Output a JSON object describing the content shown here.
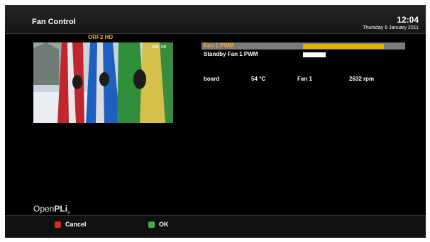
{
  "header": {
    "title": "Fan Control",
    "time": "12:04",
    "date": "Thursday  6 January 2011"
  },
  "preview": {
    "channel": "ORF2 HD",
    "watermark": "ORF HD"
  },
  "settings": [
    {
      "label": "Fan 1 PWM",
      "level": 0.78,
      "selected": true,
      "bar_color": "#e7b000"
    },
    {
      "label": "Standby Fan 1 PWM",
      "level": 0.22,
      "selected": false,
      "bar_color": "#ffffff"
    }
  ],
  "sensors": {
    "name": "board",
    "temp": "54 °C",
    "fan": "Fan 1",
    "rpm": "2632 rpm"
  },
  "brand": {
    "text_thin": "Open",
    "text_bold": "PLi",
    "suffix": "®"
  },
  "footer": {
    "red_label": "Cancel",
    "green_label": "OK"
  },
  "colors": {
    "accent": "#f0a820",
    "red_key": "#d42a2a",
    "green_key": "#3cb043"
  },
  "icons": {
    "red": "red-key-icon",
    "green": "green-key-icon"
  }
}
